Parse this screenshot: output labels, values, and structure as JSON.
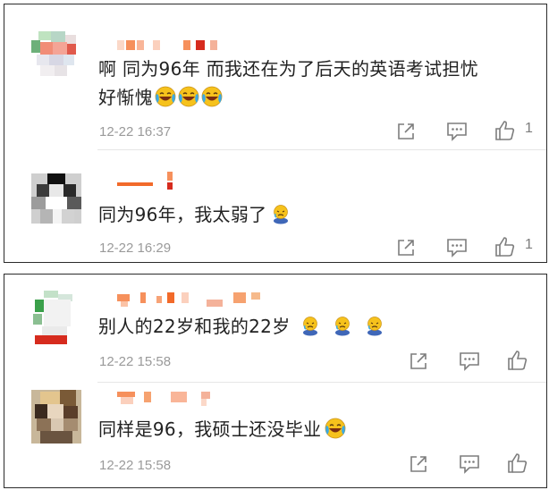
{
  "comments": [
    {
      "text": "啊  同为96年  而我还在为了后天的英语考试担忧",
      "text2": "好惭愧",
      "time": "12-22 16:37",
      "likes": "1",
      "emoji": "laughing-crying-emoji"
    },
    {
      "text": "同为96年，我太弱了",
      "time": "12-22 16:29",
      "likes": "1",
      "emoji": "sad-kneeling-emoji"
    },
    {
      "text": "别人的22岁和我的22岁",
      "time": "12-22 15:58",
      "likes": "",
      "emoji": "sad-kneeling-emoji"
    },
    {
      "text": "同样是96，我硕士还没毕业",
      "time": "12-22 15:58",
      "likes": "",
      "emoji": "laughing-crying-emoji"
    }
  ],
  "icons": {
    "share": "share-icon",
    "reply": "reply-icon",
    "like": "thumbs-up-icon"
  },
  "colors": {
    "mosaic_orange": "#f6905c",
    "mosaic_red": "#d62b1e",
    "mosaic_green": "#3aa04a",
    "muted_text": "#9a9a9a"
  }
}
